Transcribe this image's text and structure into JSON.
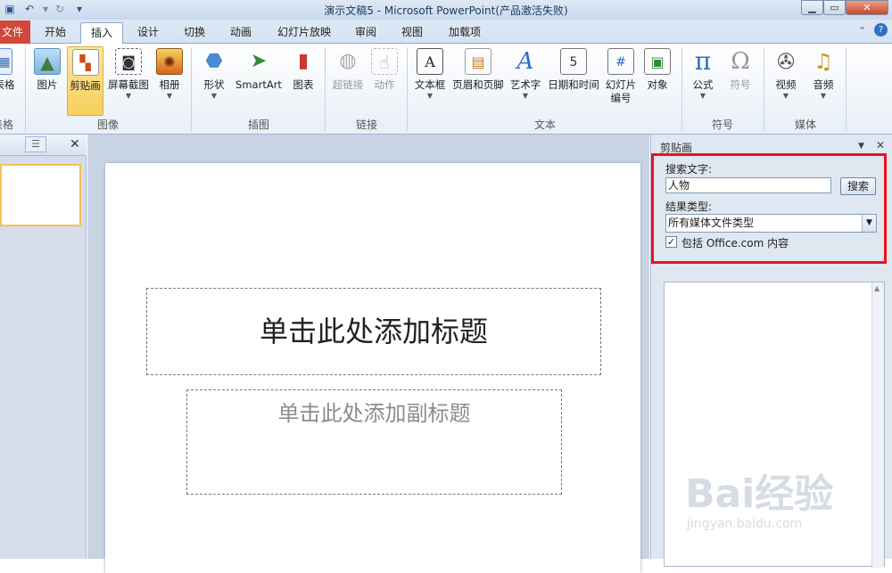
{
  "window": {
    "title": "演示文稿5 - Microsoft PowerPoint(产品激活失败)"
  },
  "tabs": {
    "file": "文件",
    "items": [
      "开始",
      "插入",
      "设计",
      "切换",
      "动画",
      "幻灯片放映",
      "审阅",
      "视图",
      "加载项"
    ],
    "active": "插入"
  },
  "ribbon": {
    "groups": {
      "table": {
        "label": "表格",
        "button": "表格"
      },
      "images": {
        "label": "图像",
        "buttons": [
          "图片",
          "剪贴画",
          "屏幕截图",
          "相册"
        ]
      },
      "illustrations": {
        "label": "插图",
        "buttons": [
          "形状",
          "SmartArt",
          "图表"
        ]
      },
      "links": {
        "label": "链接",
        "buttons": [
          "超链接",
          "动作"
        ]
      },
      "text": {
        "label": "文本",
        "buttons": [
          "文本框",
          "页眉和页脚",
          "艺术字",
          "日期和时间",
          "幻灯片编号",
          "对象"
        ]
      },
      "symbols": {
        "label": "符号",
        "buttons": [
          "公式",
          "符号"
        ]
      },
      "media": {
        "label": "媒体",
        "buttons": [
          "视频",
          "音频"
        ]
      }
    }
  },
  "slide": {
    "title_placeholder": "单击此处添加标题",
    "subtitle_placeholder": "单击此处添加副标题"
  },
  "clipart_pane": {
    "header": "剪贴画",
    "search_label": "搜索文字:",
    "search_value": "人物",
    "search_button": "搜索",
    "result_type_label": "结果类型:",
    "result_type_value": "所有媒体文件类型",
    "include_label": "包括 Office.com 内容",
    "include_checked": true
  },
  "watermark": {
    "logo": "Bai经验",
    "url": "jingyan.baidu.com"
  },
  "colors": {
    "file_tab": "#d2473a",
    "highlight_box": "#e8141c",
    "selected_button": "#f8cf5d"
  }
}
